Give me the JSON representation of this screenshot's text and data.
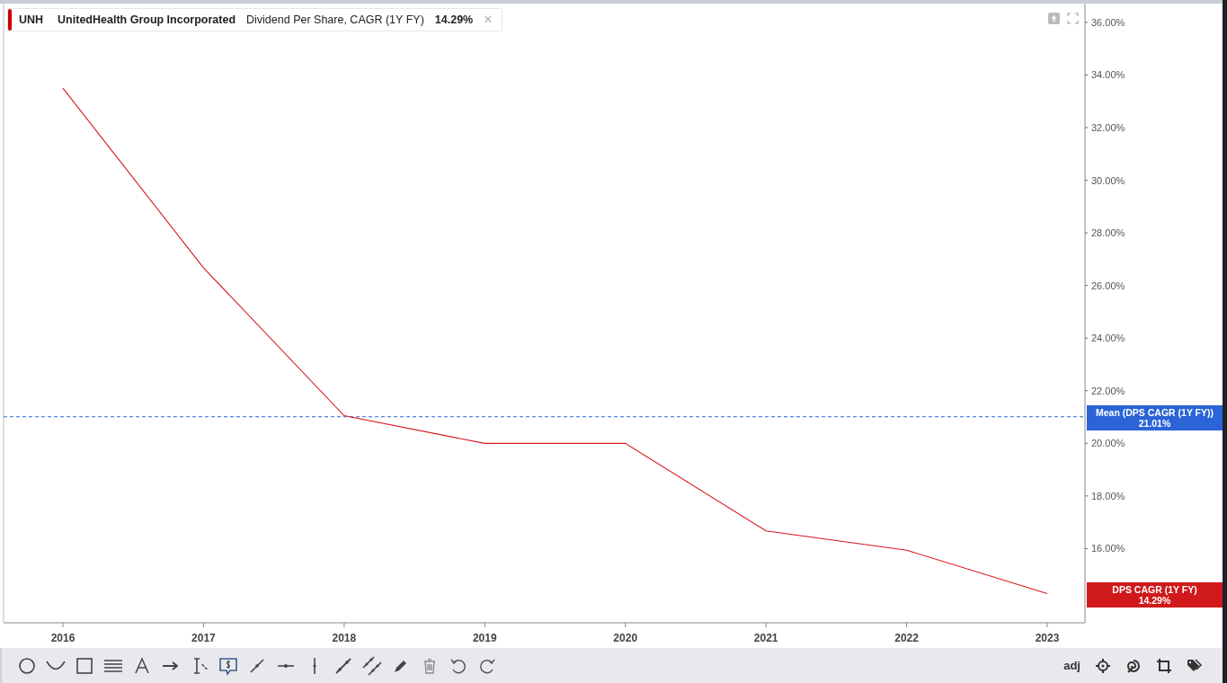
{
  "legend": {
    "ticker": "UNH",
    "company": "UnitedHealth Group Incorporated",
    "metric": "Dividend Per Share, CAGR (1Y FY)",
    "value": "14.29%",
    "color": "#cc0000",
    "close": "×"
  },
  "chart": {
    "chart_data": {
      "type": "line",
      "categories": [
        "2016",
        "2017",
        "2018",
        "2019",
        "2020",
        "2021",
        "2022",
        "2023"
      ],
      "series": [
        {
          "name": "DPS CAGR (1Y FY)",
          "color": "#d9181c",
          "values": [
            33.5,
            26.67,
            21.05,
            20.0,
            20.0,
            16.67,
            15.94,
            14.29
          ]
        }
      ],
      "ylim": [
        13.18,
        36.68
      ],
      "yticks": [
        {
          "value": 16,
          "label": "16.00%"
        },
        {
          "value": 18,
          "label": "18.00%"
        },
        {
          "value": 20,
          "label": "20.00%"
        },
        {
          "value": 22,
          "label": "22.00%"
        },
        {
          "value": 24,
          "label": "24.00%"
        },
        {
          "value": 26,
          "label": "26.00%"
        },
        {
          "value": 28,
          "label": "28.00%"
        },
        {
          "value": 30,
          "label": "30.00%"
        },
        {
          "value": 32,
          "label": "32.00%"
        },
        {
          "value": 34,
          "label": "34.00%"
        },
        {
          "value": 36,
          "label": "36.00%"
        }
      ],
      "ref_lines": [
        {
          "axis": "y",
          "value": 21.01,
          "label": "Mean (DPS CAGR (1Y FY))",
          "color": "#2a64d6"
        }
      ]
    },
    "mean_badge": {
      "value": "21.01%"
    },
    "last_badge": {
      "value": "14.29%",
      "color": "#d0191b"
    }
  },
  "toolbar": {
    "right_label": "adj"
  }
}
